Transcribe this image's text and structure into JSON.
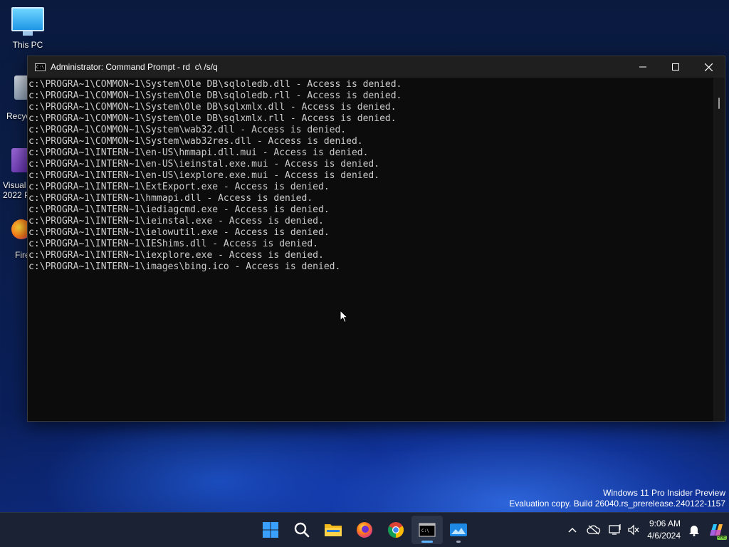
{
  "desktop": {
    "icons": [
      {
        "label": "This PC"
      },
      {
        "label": "Recyc"
      },
      {
        "label": "Visual\n2022 P"
      },
      {
        "label": "Fire"
      }
    ]
  },
  "window": {
    "title": "Administrator: Command Prompt - rd  c\\ /s/q",
    "app_icon_text": "C:\\"
  },
  "console": {
    "lines": [
      "c:\\PROGRA~1\\COMMON~1\\System\\Ole DB\\sqloledb.dll - Access is denied.",
      "c:\\PROGRA~1\\COMMON~1\\System\\Ole DB\\sqloledb.rll - Access is denied.",
      "c:\\PROGRA~1\\COMMON~1\\System\\Ole DB\\sqlxmlx.dll - Access is denied.",
      "c:\\PROGRA~1\\COMMON~1\\System\\Ole DB\\sqlxmlx.rll - Access is denied.",
      "c:\\PROGRA~1\\COMMON~1\\System\\wab32.dll - Access is denied.",
      "c:\\PROGRA~1\\COMMON~1\\System\\wab32res.dll - Access is denied.",
      "c:\\PROGRA~1\\INTERN~1\\en-US\\hmmapi.dll.mui - Access is denied.",
      "c:\\PROGRA~1\\INTERN~1\\en-US\\ieinstal.exe.mui - Access is denied.",
      "c:\\PROGRA~1\\INTERN~1\\en-US\\iexplore.exe.mui - Access is denied.",
      "c:\\PROGRA~1\\INTERN~1\\ExtExport.exe - Access is denied.",
      "c:\\PROGRA~1\\INTERN~1\\hmmapi.dll - Access is denied.",
      "c:\\PROGRA~1\\INTERN~1\\iediagcmd.exe - Access is denied.",
      "c:\\PROGRA~1\\INTERN~1\\ieinstal.exe - Access is denied.",
      "c:\\PROGRA~1\\INTERN~1\\ielowutil.exe - Access is denied.",
      "c:\\PROGRA~1\\INTERN~1\\IEShims.dll - Access is denied.",
      "c:\\PROGRA~1\\INTERN~1\\iexplore.exe - Access is denied.",
      "c:\\PROGRA~1\\INTERN~1\\images\\bing.ico - Access is denied."
    ]
  },
  "watermark": {
    "line1": "Windows 11 Pro Insider Preview",
    "line2": "Evaluation copy. Build 26040.rs_prerelease.240122-1157"
  },
  "taskbar": {
    "apps": [
      {
        "name": "start-icon"
      },
      {
        "name": "search-icon"
      },
      {
        "name": "file-explorer-icon"
      },
      {
        "name": "firefox-icon"
      },
      {
        "name": "chrome-icon"
      },
      {
        "name": "command-prompt-icon",
        "state": "active"
      },
      {
        "name": "photos-icon",
        "state": "running"
      }
    ],
    "tray": {
      "time": "9:06 AM",
      "date": "4/6/2024",
      "badge": "PRE"
    }
  },
  "colors": {
    "console_bg": "#0c0c0c",
    "console_text": "#cccccc",
    "titlebar_bg": "#1f1f1f",
    "taskbar_bg": "#1b2233",
    "active_indicator": "#5fb4ff"
  }
}
